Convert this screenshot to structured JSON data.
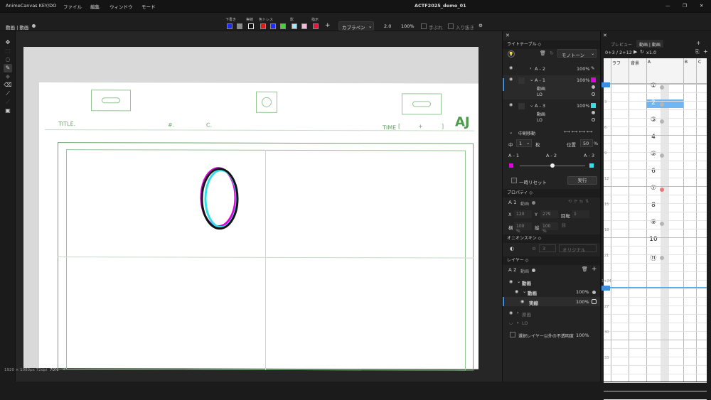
{
  "app": {
    "name": "AnimeCanvas KEY/DO",
    "menus": [
      "ファイル",
      "編集",
      "ウィンドウ",
      "モード"
    ],
    "doc_title": "ACTF2025_demo_01"
  },
  "toolbar": {
    "layer_name": "動画 | 動画",
    "swatch_labels": [
      "下書き",
      "実線",
      "色トレス",
      "影",
      "指示"
    ],
    "swatch_colors": [
      "#1a2cff",
      "#8c8c8c",
      "#111111",
      "#e21a1a",
      "#1a2cff",
      "#3ad63a",
      "#a9e6f5",
      "#f7b7d6",
      "#e21a3a"
    ],
    "add": "+",
    "pen": "カブラペン",
    "size": "2.0",
    "opacity": "100%",
    "stabilizer": "手ぶれ",
    "taper": "入り抜き"
  },
  "paper": {
    "title": "TITLE.",
    "num": "#.",
    "cut": "C.",
    "time": "TIME",
    "time_bracket_open": "[",
    "time_plus": "+",
    "time_bracket_close": "]",
    "logo_text": "AJ"
  },
  "canvas_info": {
    "size": "1920 × 1080px 72dpi",
    "zoom": "70%"
  },
  "light_table": {
    "title": "ライトテーブル",
    "mode": "モノトーン",
    "items": [
      {
        "name": "A - 2",
        "opacity": "100%"
      },
      {
        "name": "A - 1",
        "opacity": "100%",
        "sub1": "動画",
        "sub2": "LO",
        "color": "#e000e0"
      },
      {
        "name": "A - 3",
        "opacity": "100%",
        "sub1": "動画",
        "sub2": "LO",
        "color": "#33dfe6"
      }
    ],
    "inbetween": {
      "title": "中割移動",
      "mode": "中",
      "count": "1",
      "unit": "枚",
      "pos_label": "位置",
      "pos_value": "50",
      "pos_unit": "%",
      "left": "A - 1",
      "mid": "A - 2",
      "right": "A - 3",
      "slider": 0.5
    },
    "reset": "一時リセット",
    "execute": "実行"
  },
  "properties": {
    "title": "プロパティ",
    "layer": "A 1",
    "layer_type": "動画",
    "x_label": "X",
    "x_value": "120",
    "y_label": "Y",
    "y_value": "279",
    "rot_label": "回転",
    "rot_value": "1",
    "w_label": "横",
    "w_value": "100 %",
    "h_label": "縦",
    "h_value": "100 %"
  },
  "onion": {
    "title": "オニオンスキン",
    "count": "3",
    "mode": "オリジナル"
  },
  "layers": {
    "title": "レイヤー",
    "current": "A 2",
    "current_type": "動画",
    "items": [
      {
        "name": "動画",
        "opacity": ""
      },
      {
        "name": "動画",
        "opacity": "100%"
      },
      {
        "name": "実線",
        "opacity": "100%"
      },
      {
        "name": "原画",
        "opacity": ""
      },
      {
        "name": "LO",
        "opacity": ""
      }
    ],
    "footer": "選択レイヤー以外の不透明度",
    "footer_value": "100%"
  },
  "timesheet": {
    "tabs": [
      "プレビュー",
      "動画 | 動画"
    ],
    "frame": "0+3 / 2+12",
    "speed": "x1.0",
    "columns": [
      "ラフ",
      "背景",
      "A",
      "B",
      "C"
    ],
    "numbers": [
      "①",
      "2",
      "③",
      "4",
      "⑤",
      "6",
      "⑦",
      "8",
      "⑨",
      "10",
      "⑪"
    ],
    "left_numbers": [
      "3",
      "6",
      "9",
      "12",
      "15",
      "18",
      "21",
      "1+24",
      "27",
      "30",
      "33"
    ]
  }
}
